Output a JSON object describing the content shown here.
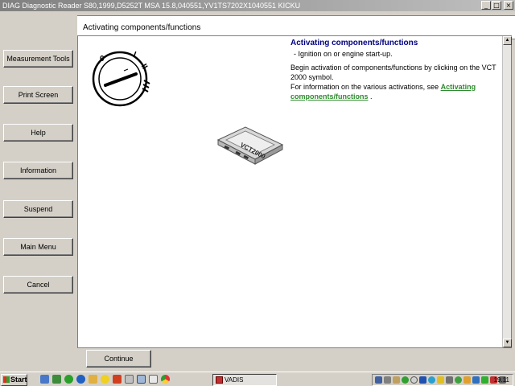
{
  "window": {
    "title": "DIAG Diagnostic Reader S80,1999,D5252T MSA 15.8,040551,YV1TS7202X1040551 KICKU",
    "controls": [
      "_",
      "□",
      "×"
    ]
  },
  "sidebar": {
    "items": [
      {
        "label": "Measurement Tools"
      },
      {
        "label": "Print Screen"
      },
      {
        "label": "Help"
      },
      {
        "label": "Information"
      },
      {
        "label": "Suspend"
      },
      {
        "label": "Main Menu"
      },
      {
        "label": "Cancel"
      }
    ]
  },
  "header": {
    "title": "Activating components/functions"
  },
  "content": {
    "title": "Activating components/functions",
    "bullet": "-  Ignition on or engine start-up.",
    "para1": "Begin activation of components/functions by clicking on the VCT 2000 symbol.",
    "para2_prefix": "For information on the various activations, see ",
    "para2_link": "Activating components/functions",
    "para2_suffix": " .",
    "vct_label": "VCT2000",
    "ignition_labels": [
      "0",
      "I",
      "II"
    ]
  },
  "footer": {
    "continue_label": "Continue"
  },
  "taskbar": {
    "start_label": "Start",
    "task_label": "VADIS",
    "clock": "19.11",
    "quick_launch_icons": [
      "desktop-icon",
      "explorer-icon",
      "green-ie-icon",
      "ie-icon",
      "folder-icon",
      "smiley-icon",
      "tools-icon",
      "edit-icon",
      "window-icon",
      "mail-icon",
      "chrome-icon"
    ],
    "tray_icons": [
      "network-icon",
      "keyboard-icon",
      "clipboard-icon",
      "sync-icon",
      "clock-icon",
      "shield-icon",
      "globe-icon",
      "pen-icon",
      "printer-icon",
      "speaker-icon",
      "folder-icon",
      "chart-icon",
      "battery-icon",
      "signal-icon",
      "volume-icon"
    ]
  }
}
